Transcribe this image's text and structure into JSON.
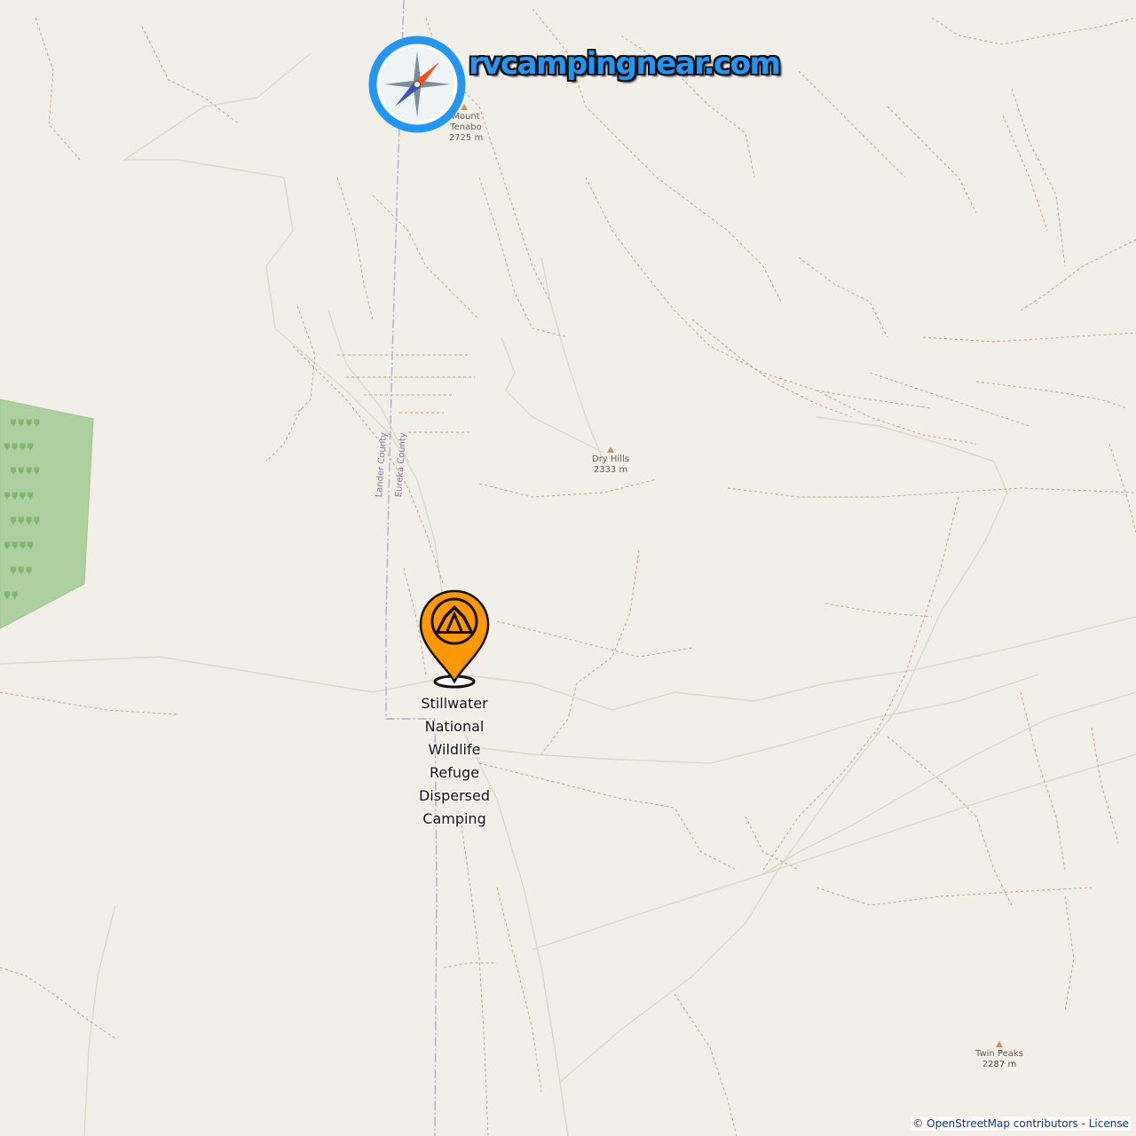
{
  "logo": {
    "text": "rvcampingnear.com",
    "compass_icon": "compass-icon"
  },
  "peaks": [
    {
      "name": "Mount Tenabo",
      "name_line1": "Mount",
      "name_line2": "Tenabo",
      "elevation": "2725 m"
    },
    {
      "name": "Dry Hills",
      "elevation": "2333 m"
    },
    {
      "name": "Twin Peaks",
      "elevation": "2287 m"
    }
  ],
  "counties": {
    "west": "Lander County",
    "east": "Eureka County"
  },
  "campsite": {
    "icon": "campsite-marker-icon",
    "label_lines": [
      "Stillwater",
      "National",
      "Wildlife",
      "Refuge",
      "Dispersed",
      "Camping"
    ]
  },
  "attribution": {
    "prefix": "©",
    "contributors_link": "OpenStreetMap contributors",
    "separator": " - ",
    "license_link": "License"
  },
  "colors": {
    "background": "#f2efe9",
    "forest": "#add19e",
    "marker_fill": "#ff9800",
    "logo_text": "#2196f3",
    "compass_ring": "#2196f3"
  }
}
